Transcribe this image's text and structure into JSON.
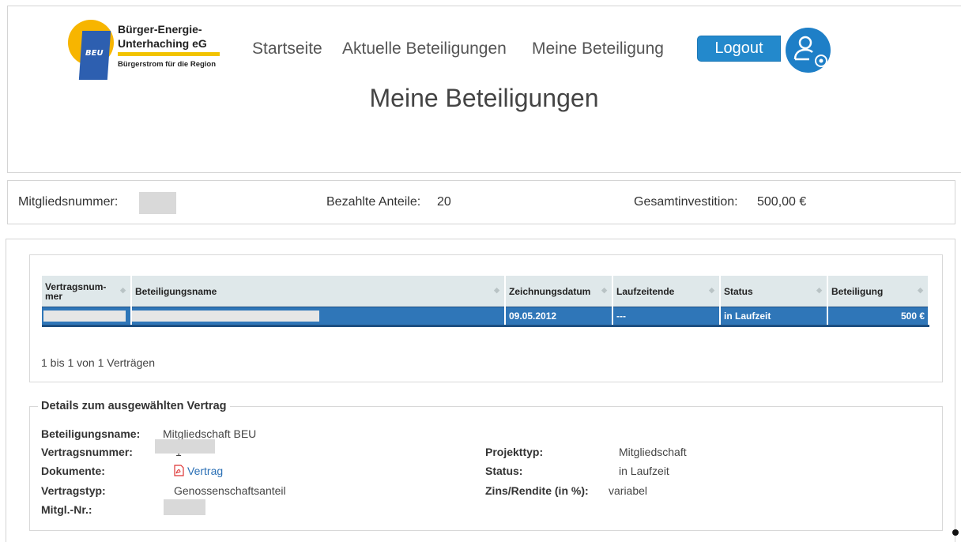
{
  "logo": {
    "line1": "Bürger-Energie-",
    "line2": "Unterhaching eG",
    "tagline": "Bürgerstrom für die Region",
    "badge": "BEU"
  },
  "nav": {
    "items": [
      "Startseite",
      "Aktuelle Beteiligungen",
      "Meine Beteiligung"
    ]
  },
  "header": {
    "logout_label": "Logout",
    "page_title": "Meine Beteiligungen",
    "user_icon": "user-settings-icon"
  },
  "summary": {
    "member_label": "Mitgliedsnummer:",
    "shares_label": "Bezahlte Anteile:",
    "shares_value": "20",
    "total_label": "Gesamtinvestition:",
    "total_value": "500,00 €"
  },
  "contracts": {
    "columns": [
      "Vertragsnum-\nmer",
      "Beteiligungsname",
      "Zeichnungsdatum",
      "Laufzeitende",
      "Status",
      "Beteiligung"
    ],
    "rows": [
      {
        "nummer": "",
        "name": "",
        "datum": "09.05.2012",
        "ende": "---",
        "status": "in Laufzeit",
        "betrag": "500 €"
      }
    ],
    "pager": "1 bis 1 von 1 Verträgen"
  },
  "details": {
    "legend": "Details zum ausgewählten Vertrag",
    "name_label": "Beteiligungsname:",
    "name_value": "Mitgliedschaft BEU",
    "nummer_label": "Vertragsnummer:",
    "nummer_value": "1",
    "dokumente_label": "Dokumente:",
    "dokumente_link": "Vertrag",
    "typ_label": "Vertragstyp:",
    "typ_value": "Genossenschaftsanteil",
    "mitgl_label": "Mitgl.-Nr.:",
    "projekttyp_label": "Projekttyp:",
    "projekttyp_value": "Mitgliedschaft",
    "status_label": "Status:",
    "status_value": "in Laufzeit",
    "zins_label": "Zins/Rendite (in %):",
    "zins_value": "variabel"
  },
  "colors": {
    "accent": "#2f76b8",
    "button": "#2389cc",
    "logo_sun": "#f7b500"
  }
}
